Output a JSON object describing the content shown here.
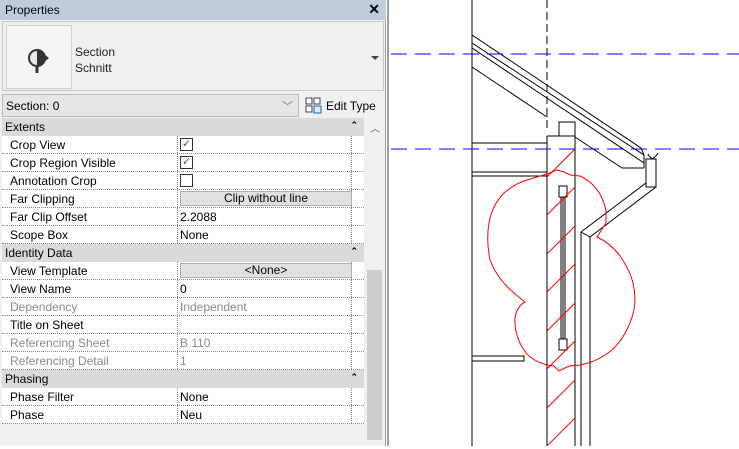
{
  "title": "Properties",
  "type_selector": {
    "family": "Section",
    "type": "Schnitt",
    "icon": "section-marker-icon"
  },
  "instance": {
    "label": "Section: 0"
  },
  "edit_type_label": "Edit Type",
  "sections": [
    {
      "title": "Extents",
      "rows": [
        {
          "name": "Crop View",
          "kind": "checkbox",
          "checked": true
        },
        {
          "name": "Crop Region Visible",
          "kind": "checkbox",
          "checked": true
        },
        {
          "name": "Annotation Crop",
          "kind": "checkbox",
          "checked": false
        },
        {
          "name": "Far Clipping",
          "kind": "button",
          "value": "Clip without line"
        },
        {
          "name": "Far Clip Offset",
          "value": "2.2088"
        },
        {
          "name": "Scope Box",
          "value": "None"
        }
      ]
    },
    {
      "title": "Identity Data",
      "rows": [
        {
          "name": "View Template",
          "kind": "button",
          "value": "<None>"
        },
        {
          "name": "View Name",
          "value": "0"
        },
        {
          "name": "Dependency",
          "value": "Independent",
          "readonly": true
        },
        {
          "name": "Title on Sheet",
          "value": ""
        },
        {
          "name": "Referencing Sheet",
          "value": "B 110",
          "readonly": true
        },
        {
          "name": "Referencing Detail",
          "value": "1",
          "readonly": true
        }
      ]
    },
    {
      "title": "Phasing",
      "rows": [
        {
          "name": "Phase Filter",
          "value": "None"
        },
        {
          "name": "Phase",
          "value": "Neu"
        }
      ]
    }
  ],
  "colors": {
    "titlebar": "#bfcddb",
    "level_line": "#0000ff",
    "revision_cloud": "#ff0000"
  }
}
